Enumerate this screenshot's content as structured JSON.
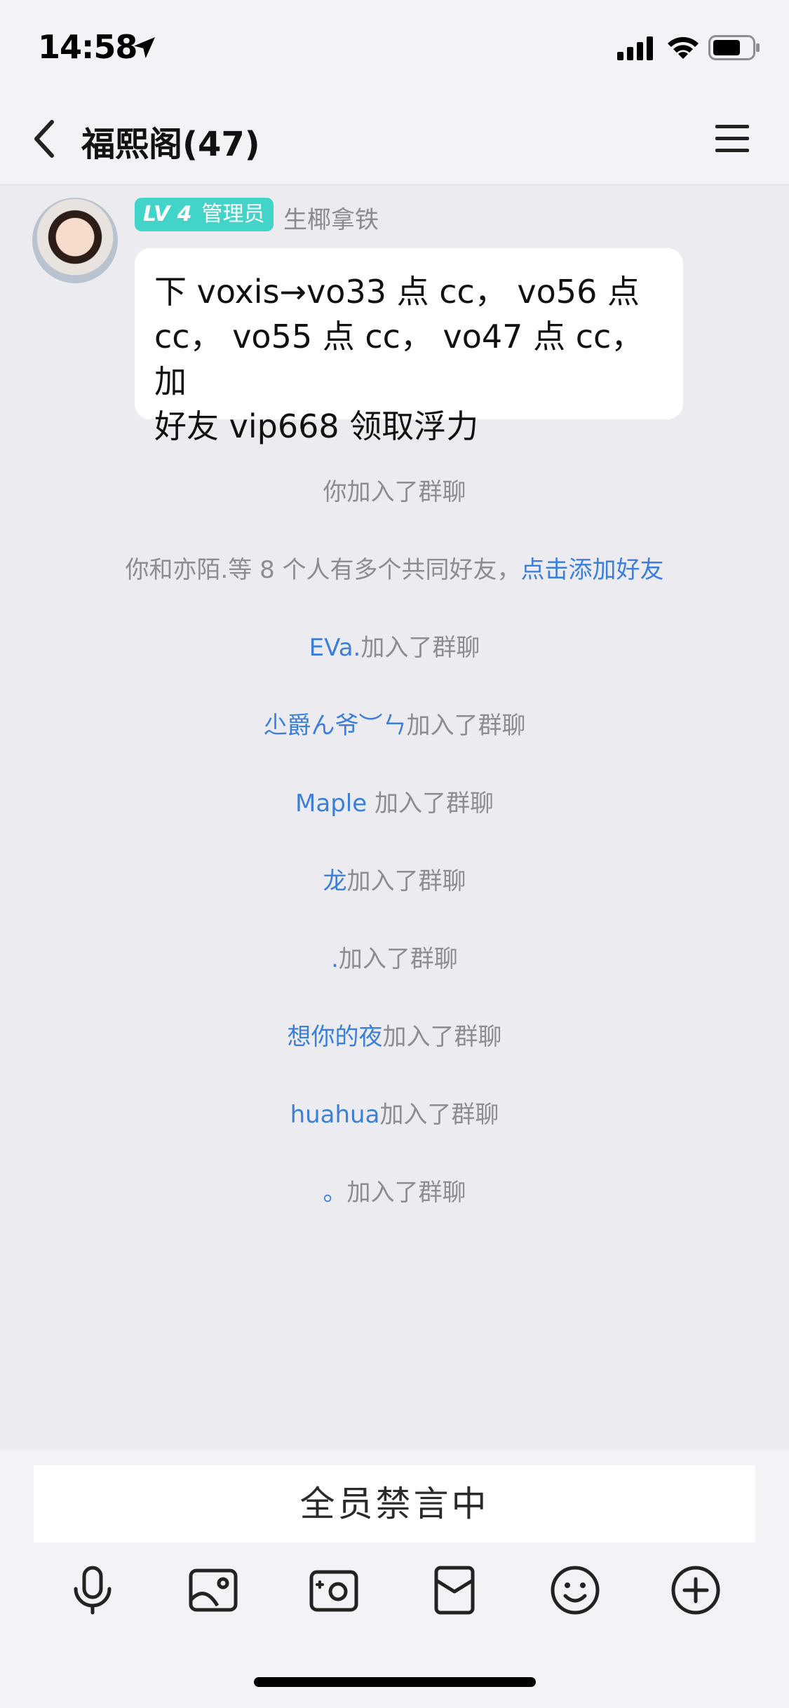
{
  "status_bar": {
    "time": "14:58",
    "icons": [
      "location-arrow-icon",
      "signal-icon",
      "wifi-icon",
      "battery-icon"
    ]
  },
  "nav": {
    "back_icon": "chevron-left-icon",
    "title": "福熙阁(47)",
    "menu_icon": "hamburger-menu-icon"
  },
  "message": {
    "level": "LV 4",
    "role": "管理员",
    "sender": "生椰拿铁",
    "lines": [
      "下 voxis→vo33 点 cc， vo56 点",
      "cc， vo55 点 cc， vo47 点 cc， 加",
      "好友 vip668 领取浮力"
    ],
    "badge_color": "#42d4c8"
  },
  "notices": {
    "you_joined": "你加入了群聊",
    "mutual_prefix": "你和亦陌.等 8 个人有多个共同好友，",
    "mutual_link": "点击添加好友",
    "joined_suffix": "加入了群聊",
    "members": [
      "EVa.",
      "尐爵ん爷︶ㄣ",
      "Maple",
      "龙",
      ".",
      "想你的夜",
      "huahua",
      "。"
    ]
  },
  "bottom": {
    "muted_text": "全员禁言中",
    "toolbar": [
      "microphone-icon",
      "image-icon",
      "camera-icon",
      "red-packet-icon",
      "emoji-icon",
      "plus-icon"
    ]
  },
  "colors": {
    "link": "#3b7fd8",
    "notice_text": "#8c8c92",
    "background": "#ececf0"
  }
}
